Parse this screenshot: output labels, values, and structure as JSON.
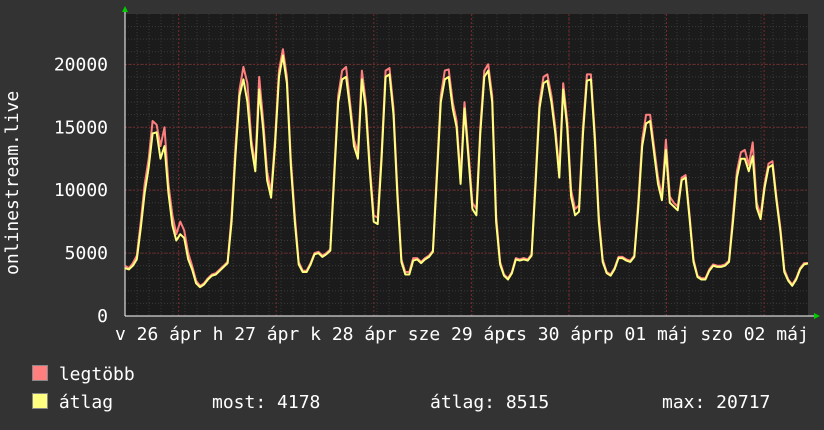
{
  "chart_data": {
    "type": "line",
    "ylabel": "onlinestream.live",
    "ylim": [
      0,
      24000
    ],
    "yticks": [
      0,
      5000,
      10000,
      15000,
      20000
    ],
    "grid": true,
    "xtick_labels": [
      "v 26 ápr",
      "h 27 ápr",
      "k 28 ápr",
      "sze 29 ápr",
      "cs 30 ápr",
      "p 01 máj",
      "szo 02 máj"
    ],
    "series": [
      {
        "name": "legtöbb",
        "color": "#ff7f7f",
        "values": [
          4000,
          3800,
          4200,
          4800,
          7500,
          10500,
          12500,
          15500,
          15200,
          13500,
          15000,
          10500,
          8000,
          6500,
          7500,
          6800,
          5000,
          4000,
          2800,
          2400,
          2600,
          3000,
          3300,
          3400,
          3700,
          4000,
          4300,
          8000,
          13500,
          18000,
          19800,
          18500,
          14000,
          12000,
          19000,
          15500,
          11500,
          9800,
          14000,
          19500,
          21200,
          19000,
          12500,
          8000,
          4300,
          3600,
          3600,
          4200,
          5000,
          5100,
          4800,
          5000,
          5300,
          11500,
          17500,
          19500,
          19800,
          17000,
          14000,
          13000,
          19500,
          17000,
          12000,
          8000,
          7800,
          13000,
          19500,
          19700,
          16500,
          10000,
          4500,
          3500,
          3500,
          4600,
          4600,
          4300,
          4600,
          4800,
          5200,
          11500,
          17500,
          19500,
          19600,
          17000,
          15500,
          11000,
          17000,
          13000,
          9000,
          8500,
          15000,
          19500,
          20000,
          17500,
          8000,
          4300,
          3300,
          3000,
          3500,
          4600,
          4500,
          4600,
          4500,
          4900,
          11000,
          17000,
          19000,
          19200,
          17500,
          15000,
          11500,
          18500,
          15500,
          10000,
          8500,
          8800,
          15000,
          19200,
          19200,
          14500,
          8000,
          4500,
          3500,
          3300,
          3800,
          4700,
          4700,
          4500,
          4400,
          4800,
          9000,
          14000,
          16000,
          16000,
          13500,
          11000,
          9500,
          14000,
          9500,
          9000,
          8700,
          11000,
          11200,
          8000,
          4500,
          3200,
          3000,
          3000,
          3700,
          4100,
          4000,
          4000,
          4100,
          4400,
          8000,
          11500,
          13000,
          13200,
          12000,
          13800,
          9000,
          8000,
          10500,
          12100,
          12300,
          9500,
          7000,
          3700,
          2900,
          2500,
          3000,
          3800,
          4200,
          4200
        ]
      },
      {
        "name": "átlag",
        "color": "#ffff80",
        "values": [
          3800,
          3700,
          4000,
          4500,
          7000,
          9800,
          11800,
          14500,
          14600,
          12500,
          13500,
          9800,
          7200,
          6000,
          6500,
          6200,
          4500,
          3700,
          2600,
          2300,
          2500,
          2900,
          3200,
          3300,
          3600,
          3900,
          4200,
          7500,
          12800,
          17500,
          18800,
          17000,
          13500,
          11500,
          18000,
          14800,
          10800,
          9400,
          13500,
          19000,
          20700,
          18500,
          12000,
          7500,
          4100,
          3500,
          3500,
          4100,
          4900,
          5000,
          4700,
          4900,
          5200,
          11000,
          17000,
          18800,
          19000,
          16500,
          13500,
          12500,
          18800,
          16500,
          11500,
          7500,
          7300,
          12500,
          19000,
          19200,
          16000,
          9500,
          4300,
          3300,
          3300,
          4400,
          4500,
          4200,
          4500,
          4700,
          5100,
          11000,
          17000,
          18800,
          19000,
          16500,
          15000,
          10500,
          16500,
          12500,
          8500,
          8000,
          14500,
          19000,
          19500,
          17000,
          7500,
          4100,
          3200,
          2900,
          3400,
          4500,
          4400,
          4500,
          4400,
          4800,
          10500,
          16500,
          18500,
          18700,
          17000,
          14500,
          11000,
          18000,
          15000,
          9500,
          8000,
          8300,
          14500,
          18700,
          18800,
          14000,
          7500,
          4300,
          3400,
          3200,
          3700,
          4600,
          4600,
          4400,
          4300,
          4700,
          8500,
          13500,
          15300,
          15500,
          13000,
          10500,
          9200,
          13200,
          9000,
          8700,
          8400,
          10800,
          11000,
          7700,
          4300,
          3100,
          2900,
          2900,
          3600,
          4000,
          3900,
          3900,
          4000,
          4300,
          7500,
          11000,
          12500,
          12500,
          11500,
          12700,
          8600,
          7700,
          10200,
          11800,
          12000,
          9200,
          6700,
          3500,
          2800,
          2400,
          2900,
          3700,
          4100,
          4178
        ]
      }
    ]
  },
  "legend": {
    "max_label": "legtöbb",
    "avg_label": "átlag"
  },
  "stats": {
    "current": "most: 4178",
    "average": "átlag: 8515",
    "max": "max: 20717"
  }
}
